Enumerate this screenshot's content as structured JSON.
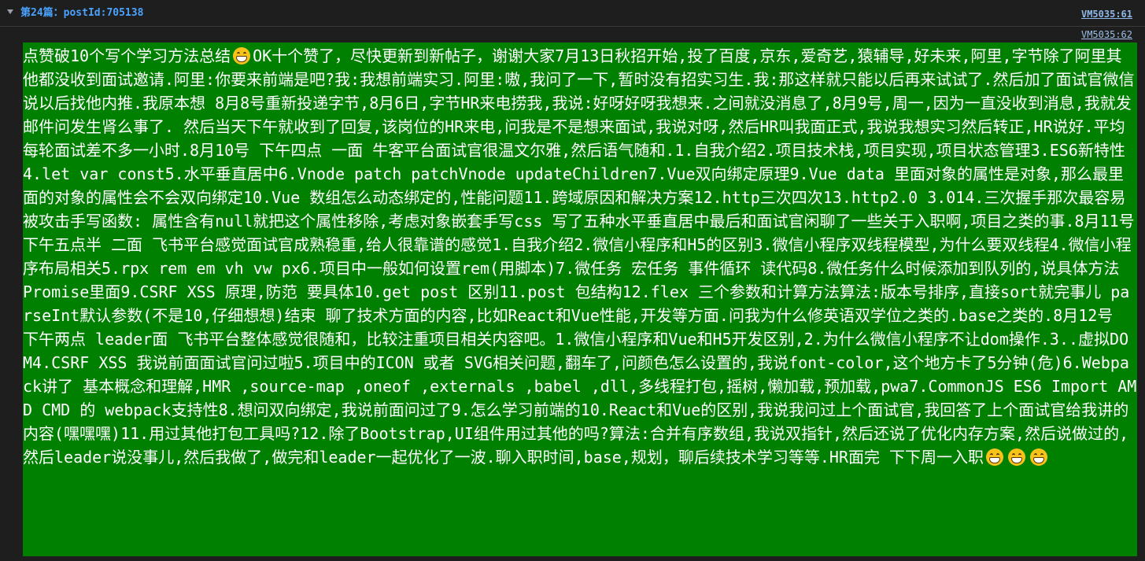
{
  "console": {
    "group_title": "第24篇：postId:705138",
    "source_link_1": "VM5035:61",
    "source_link_2": "VM5035:62"
  },
  "post": {
    "segments": [
      {
        "type": "text",
        "text": "点赞破10个写个学习方法总结"
      },
      {
        "type": "emoji",
        "icon": "grinning-face-icon"
      },
      {
        "type": "text",
        "text": "OK十个赞了，尽快更新到新帖子，谢谢大家7月13日秋招开始,投了百度,京东,爱奇艺,猿辅导,好未来,阿里,字节除了阿里其他都没收到面试邀请.阿里:你要来前端是吧?我:我想前端实习.阿里:嗷,我问了一下,暂时没有招实习生.我:那这样就只能以后再来试试了.然后加了面试官微信说以后找他内推.我原本想 8月8号重新投递字节,8月6日,字节HR来电捞我,我说:好呀好呀我想来.之间就没消息了,8月9号,周一,因为一直没收到消息,我就发邮件问发生肾么事了. 然后当天下午就收到了回复,该岗位的HR来电,问我是不是想来面试,我说对呀,然后HR叫我面正式,我说我想实习然后转正,HR说好.平均每轮面试差不多一小时.8月10号 下午四点 一面 牛客平台面试官很温文尔雅,然后语气随和.1.自我介绍2.项目技术栈,项目实现,项目状态管理3.ES6新特性4.let var const5.水平垂直居中6.Vnode patch patchVnode updateChildren7.Vue双向绑定原理9.Vue data 里面对象的属性是对象,那么最里面的对象的属性会不会双向绑定10.Vue 数组怎么动态绑定的,性能问题11.跨域原因和解决方案12.http三次四次13.http2.0 3.014.三次握手那次最容易被攻击手写函数: 属性含有null就把这个属性移除,考虑对象嵌套手写css 写了五种水平垂直居中最后和面试官闲聊了一些关于入职啊,项目之类的事.8月11号 下午五点半 二面 飞书平台感觉面试官成熟稳重,给人很靠谱的感觉1.自我介绍2.微信小程序和H5的区别3.微信小程序双线程模型,为什么要双线程4.微信小程序布局相关5.rpx rem em vh vw px6.项目中一般如何设置rem(用脚本)7.微任务 宏任务 事件循环 读代码8.微任务什么时候添加到队列的,说具体方法 Promise里面9.CSRF XSS 原理,防范 要具体10.get post 区别11.post 包结构12.flex 三个参数和计算方法算法:版本号排序,直接sort就完事儿 parseInt默认参数(不是10,仔细想想)结束 聊了技术方面的内容,比如React和Vue性能,开发等方面.问我为什么修英语双学位之类的.base之类的.8月12号 下午两点 leader面 飞书平台整体感觉很随和，比较注重项目相关内容吧。1.微信小程序和Vue和H5开发区别,2.为什么微信小程序不让dom操作.3..虚拟DOM4.CSRF XSS 我说前面面试官问过啦5.项目中的ICON 或者 SVG相关问题,翻车了,问颜色怎么设置的,我说font-color,这个地方卡了5分钟(危)6.Webpack讲了 基本概念和理解,HMR ,source-map ,oneof ,externals ,babel ,dll,多线程打包,摇树,懒加载,预加载,pwa7.CommonJS ES6 Import AMD CMD 的 webpack支持性8.想问双向绑定,我说前面问过了9.怎么学习前端的10.React和Vue的区别,我说我问过上个面试官,我回答了上个面试官给我讲的内容(嘿嘿嘿)11.用过其他打包工具吗?12.除了Bootstrap,UI组件用过其他的吗?算法:合并有序数组,我说双指针,然后还说了优化内存方案,然后说做过的,然后leader说没事儿,然后我做了,做完和leader一起优化了一波.聊入职时间,base,规划，聊后续技术学习等等.HR面完 下下周一入职"
      },
      {
        "type": "emoji",
        "icon": "grinning-face-icon"
      },
      {
        "type": "emoji",
        "icon": "grinning-face-icon"
      },
      {
        "type": "emoji",
        "icon": "grinning-face-icon"
      }
    ]
  },
  "colors": {
    "background": "#1e1e1e",
    "highlight": "#008000",
    "title": "#4aa3ff",
    "link": "#8fb8e8"
  }
}
